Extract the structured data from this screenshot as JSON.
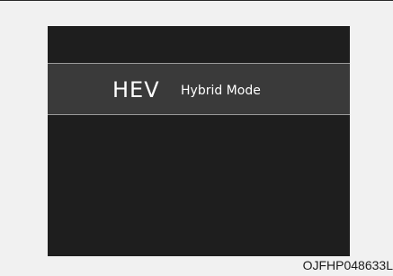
{
  "display": {
    "mode_abbreviation": "HEV",
    "mode_name": "Hybrid Mode"
  },
  "figure_code": "OJFHP048633L",
  "colors": {
    "screen_background": "#1e1e1e",
    "mode_band_background": "#3a3a3a",
    "mode_band_border": "#9a9a9a",
    "display_text": "#ffffff",
    "page_background": "#f1f1f1"
  }
}
